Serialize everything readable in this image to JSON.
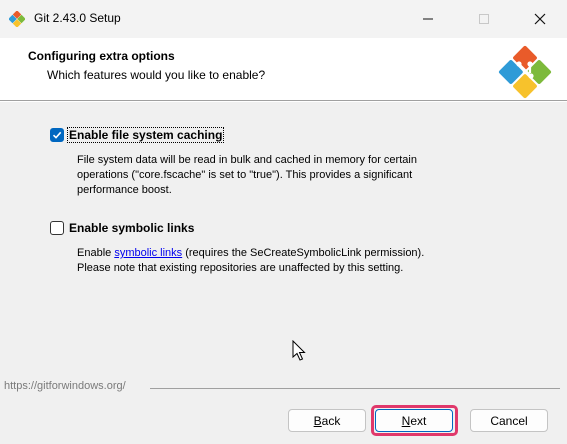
{
  "window": {
    "title": "Git 2.43.0 Setup",
    "icon": "git-logo-icon",
    "controls": [
      "minimize-icon",
      "maximize-icon",
      "close-icon"
    ]
  },
  "header": {
    "title": "Configuring extra options",
    "subtitle": "Which features would you like to enable?"
  },
  "options": [
    {
      "label": "Enable file system caching",
      "checked": true,
      "focused": true,
      "description_lines": [
        "File system data will be read in bulk and cached in memory for certain",
        "operations (\"core.fscache\" is set to \"true\"). This provides a significant",
        "performance boost."
      ]
    },
    {
      "label": "Enable symbolic links",
      "checked": false,
      "description_prefix": "Enable ",
      "description_link": "symbolic links",
      "description_suffix": " (requires the SeCreateSymbolicLink permission).",
      "description_line2": "Please note that existing repositories are unaffected by this setting."
    }
  ],
  "footer": {
    "url": "https://gitforwindows.org/",
    "buttons": {
      "back": {
        "pre": "",
        "accel": "B",
        "post": "ack"
      },
      "next": {
        "pre": "",
        "accel": "N",
        "post": "ext"
      },
      "cancel": "Cancel"
    }
  },
  "colors": {
    "accent": "#0067c0",
    "highlight": "#e0386b",
    "link": "#0000ee"
  }
}
